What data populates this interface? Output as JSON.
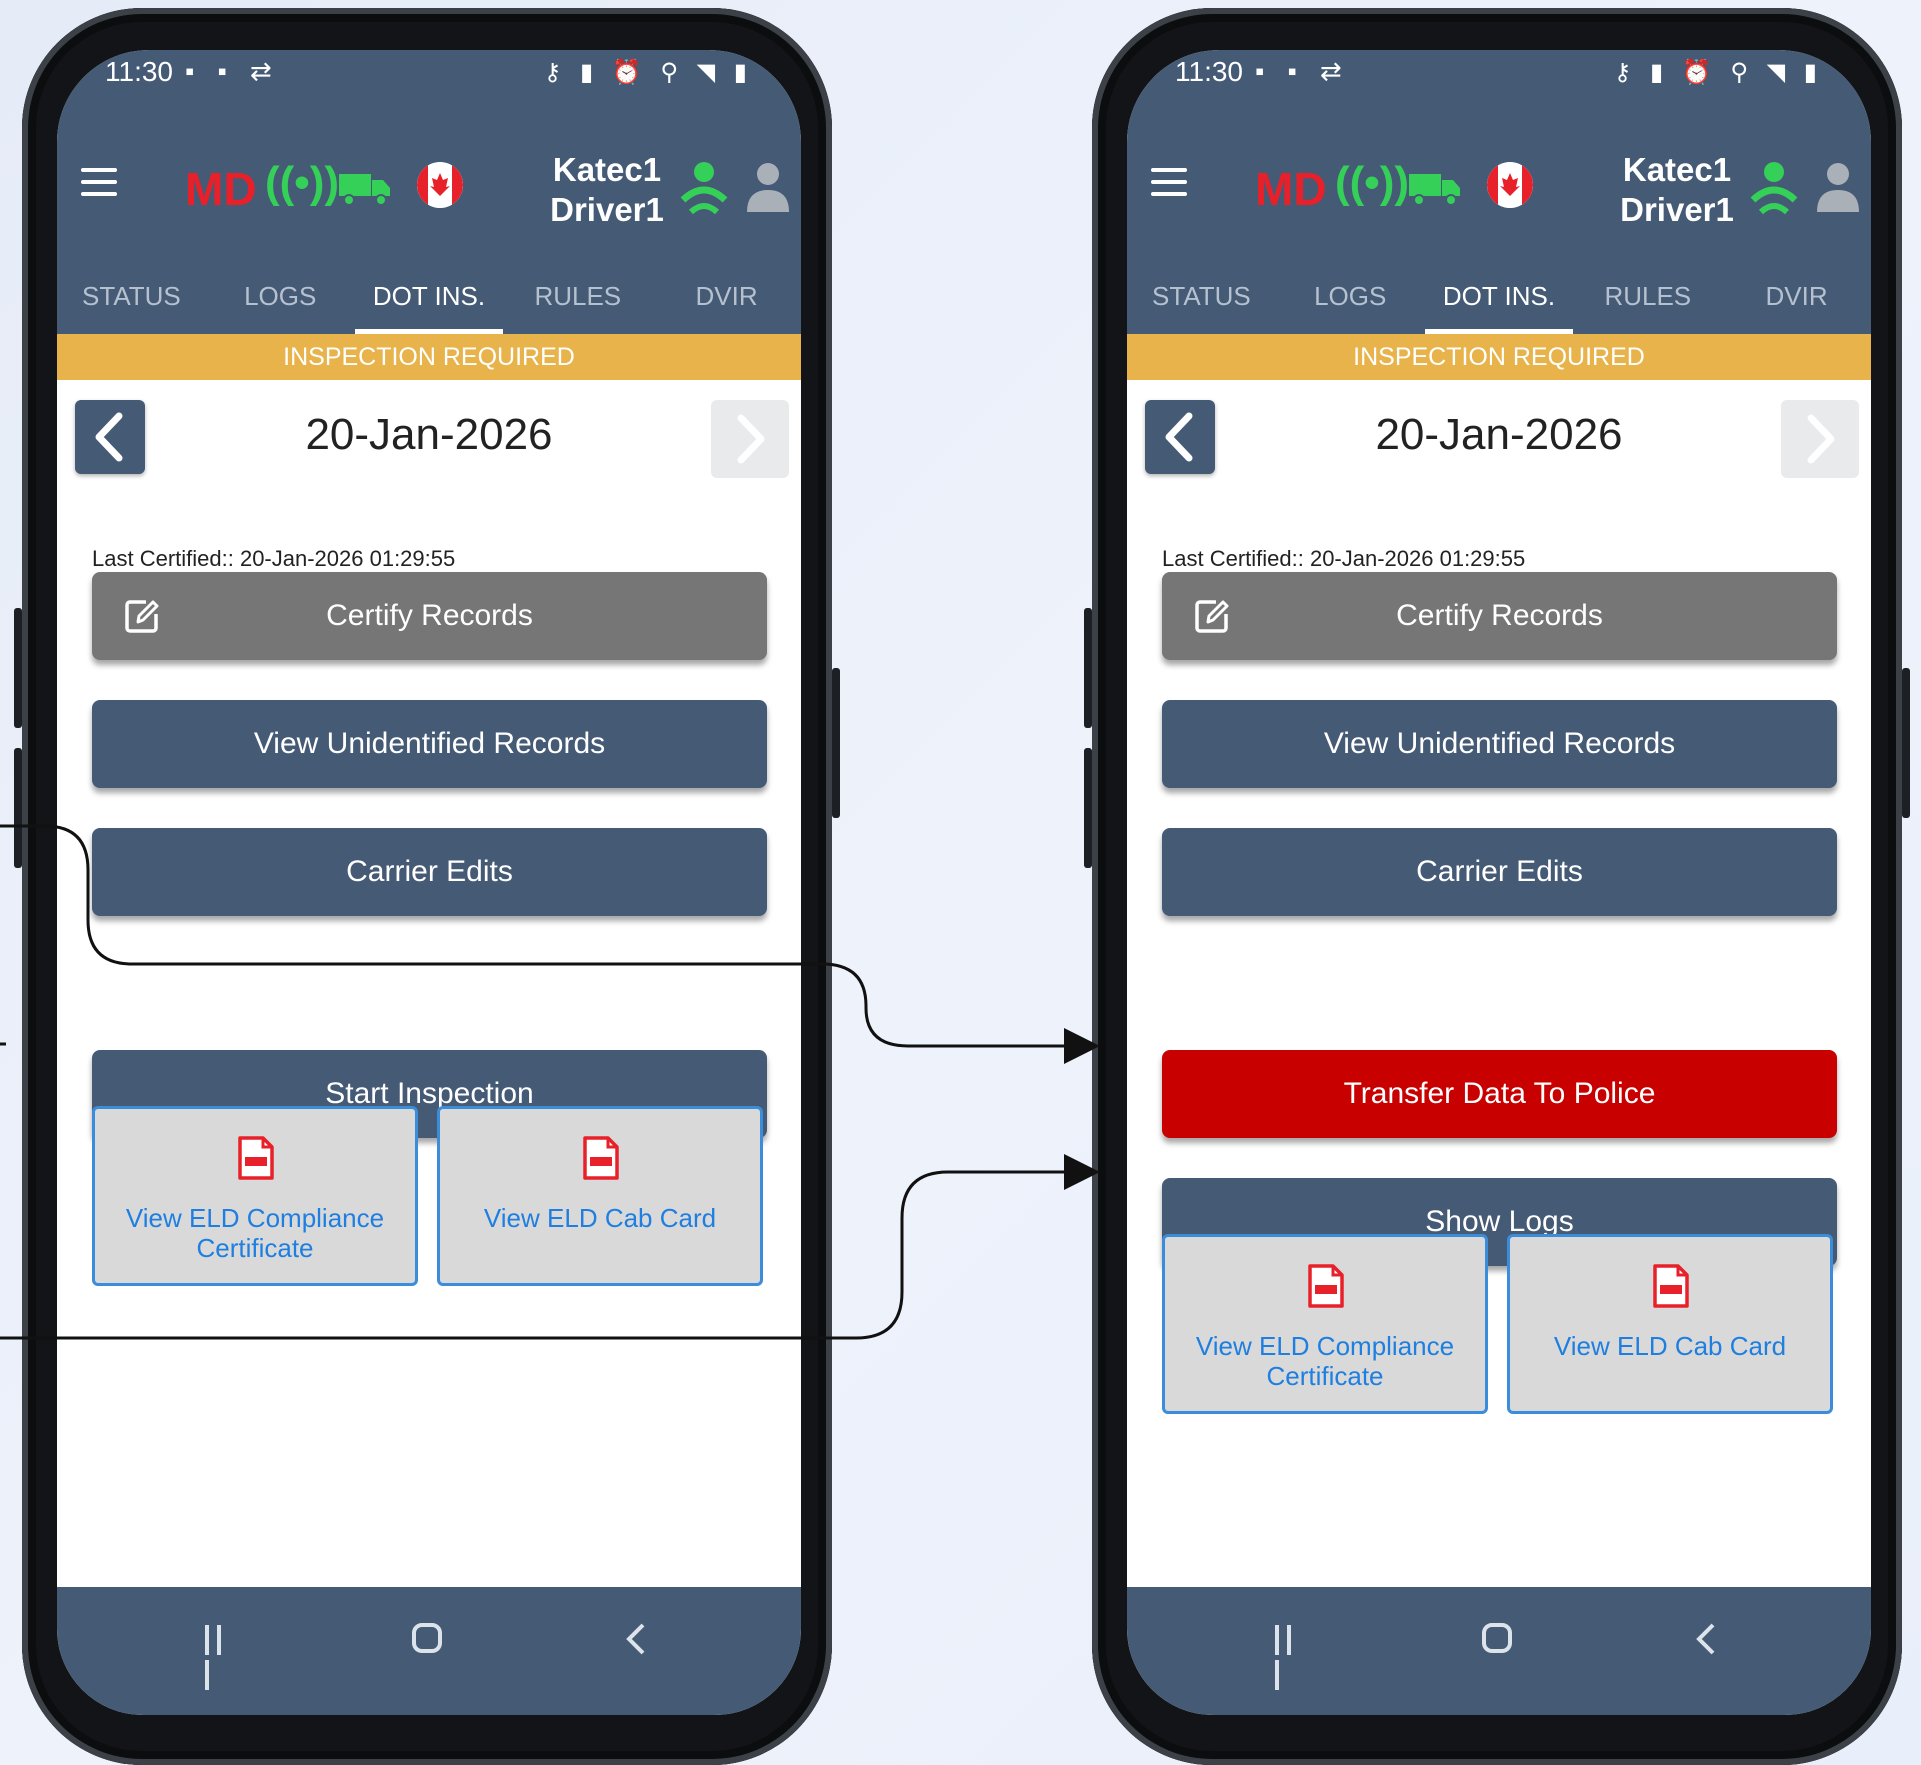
{
  "phones": [
    {
      "status_time": "11:30",
      "header": {
        "md_label": "MD",
        "driver_line1": "Katec1",
        "driver_line2": "Driver1"
      },
      "tabs": [
        "STATUS",
        "LOGS",
        "DOT INS.",
        "RULES",
        "DVIR"
      ],
      "active_tab": "DOT INS.",
      "banner": "INSPECTION REQUIRED",
      "date": "20-Jan-2026",
      "last_certified": "Last Certified:: 20-Jan-2026 01:29:55",
      "buttons": {
        "certify": "Certify Records",
        "unidentified": "View Unidentified Records",
        "carrier_edits": "Carrier Edits",
        "start_inspection": "Start Inspection"
      },
      "cards": {
        "compliance": "View ELD Compliance Certificate",
        "cab_card": "View ELD Cab Card"
      }
    },
    {
      "status_time": "11:30",
      "header": {
        "md_label": "MD",
        "driver_line1": "Katec1",
        "driver_line2": "Driver1"
      },
      "tabs": [
        "STATUS",
        "LOGS",
        "DOT INS.",
        "RULES",
        "DVIR"
      ],
      "active_tab": "DOT INS.",
      "banner": "INSPECTION REQUIRED",
      "date": "20-Jan-2026",
      "last_certified": "Last Certified:: 20-Jan-2026 01:29:55",
      "buttons": {
        "certify": "Certify Records",
        "unidentified": "View Unidentified Records",
        "carrier_edits": "Carrier Edits",
        "transfer": "Transfer Data To Police",
        "show_logs": "Show Logs"
      },
      "cards": {
        "compliance": "View ELD Compliance Certificate",
        "cab_card": "View ELD Cab Card"
      }
    }
  ],
  "colors": {
    "header": "#455a75",
    "banner": "#e7b34a",
    "transfer": "#c80000",
    "certify": "#767676",
    "link": "#1e7fe0",
    "md": "#e8202a",
    "status_green": "#34d058"
  },
  "icons": [
    "menu-icon",
    "signal-icon",
    "truck-icon",
    "canada-flag-icon",
    "driver-active-icon",
    "driver-inactive-icon",
    "chevron-left-icon",
    "chevron-right-icon",
    "edit-icon",
    "pdf-icon",
    "recent-apps-icon",
    "home-icon",
    "back-icon"
  ]
}
